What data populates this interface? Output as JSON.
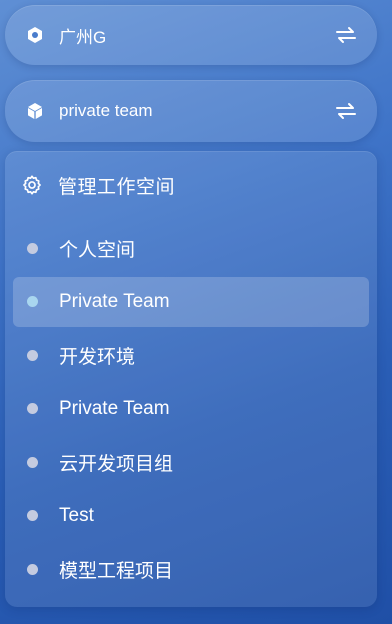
{
  "region_selector": {
    "label": "广州G",
    "icon": "hexagon-icon",
    "action_icon": "swap-arrows-icon"
  },
  "team_selector": {
    "label": "private team",
    "icon": "cube-icon",
    "action_icon": "swap-arrows-icon"
  },
  "workspace_panel": {
    "header": {
      "icon": "gear-icon",
      "title": "管理工作空间"
    },
    "items": [
      {
        "label": "个人空间",
        "active": false
      },
      {
        "label": "Private Team",
        "active": true
      },
      {
        "label": "开发环境",
        "active": false
      },
      {
        "label": "Private Team",
        "active": false
      },
      {
        "label": "云开发项目组",
        "active": false
      },
      {
        "label": "Test",
        "active": false
      },
      {
        "label": "模型工程项目",
        "active": false
      }
    ]
  },
  "colors": {
    "dot_default": "#c4cbe0",
    "dot_active": "#a9d6ef",
    "background_top": "#5f8fd4",
    "background_bottom": "#1f4fa6"
  }
}
